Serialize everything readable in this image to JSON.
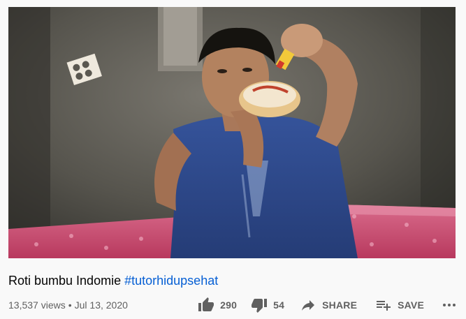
{
  "video": {
    "title": "Roti bumbu Indomie",
    "hashtag": "#tutorhidupsehat",
    "views": "13,537 views",
    "separator": "•",
    "date": "Jul 13, 2020"
  },
  "actions": {
    "like_count": "290",
    "dislike_count": "54",
    "share_label": "SHARE",
    "save_label": "SAVE"
  },
  "colors": {
    "hashtag": "#065fd4",
    "text": "#030303",
    "secondary": "#606060",
    "background": "#f9f9f9"
  },
  "icons": [
    "thumb-up-icon",
    "thumb-down-icon",
    "share-arrow-icon",
    "playlist-add-icon",
    "more-icon"
  ]
}
